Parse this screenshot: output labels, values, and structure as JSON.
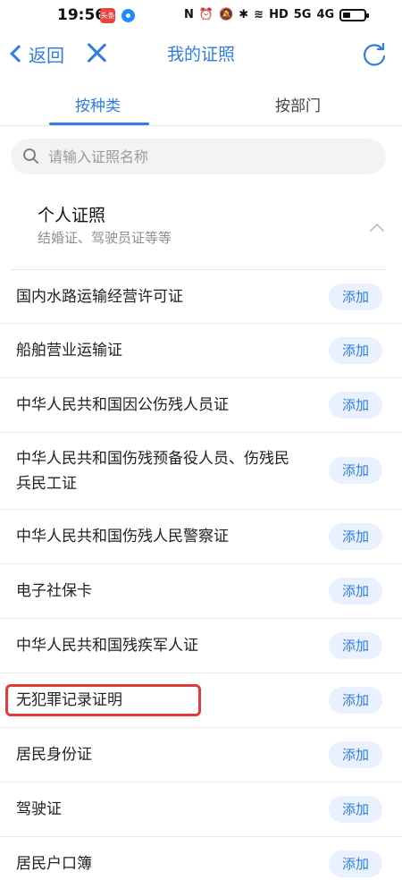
{
  "status_bar": {
    "time": "19:56",
    "app_icon_label": "头条",
    "network": "HD",
    "signal_1": "5G",
    "signal_2": "4G"
  },
  "nav": {
    "back_label": "返回",
    "title": "我的证照",
    "back_icon": "chevron-left-icon",
    "close_icon": "close-icon",
    "refresh_icon": "refresh-icon"
  },
  "tabs": [
    {
      "label": "按种类",
      "active": true
    },
    {
      "label": "按部门",
      "active": false
    }
  ],
  "search": {
    "placeholder": "请输入证照名称"
  },
  "category": {
    "title": "个人证照",
    "subtitle": "结婚证、驾驶员证等等"
  },
  "add_label": "添加",
  "items": [
    {
      "label": "国内水路运输经营许可证"
    },
    {
      "label": "船舶营业运输证"
    },
    {
      "label": "中华人民共和国因公伤残人员证"
    },
    {
      "label": "中华人民共和国伤残预备役人员、伤残民兵民工证",
      "line1": "中华人民共和国伤残预备役人员、伤残民",
      "line2": "兵民工证"
    },
    {
      "label": "中华人民共和国伤残人民警察证"
    },
    {
      "label": "电子社保卡"
    },
    {
      "label": "中华人民共和国残疾军人证"
    },
    {
      "label": "无犯罪记录证明"
    },
    {
      "label": "居民身份证"
    },
    {
      "label": "驾驶证"
    },
    {
      "label": "居民户口簿"
    }
  ],
  "colors": {
    "accent": "#2f7de1",
    "button_bg": "#e8f1fd",
    "highlight": "#e23b3b"
  }
}
